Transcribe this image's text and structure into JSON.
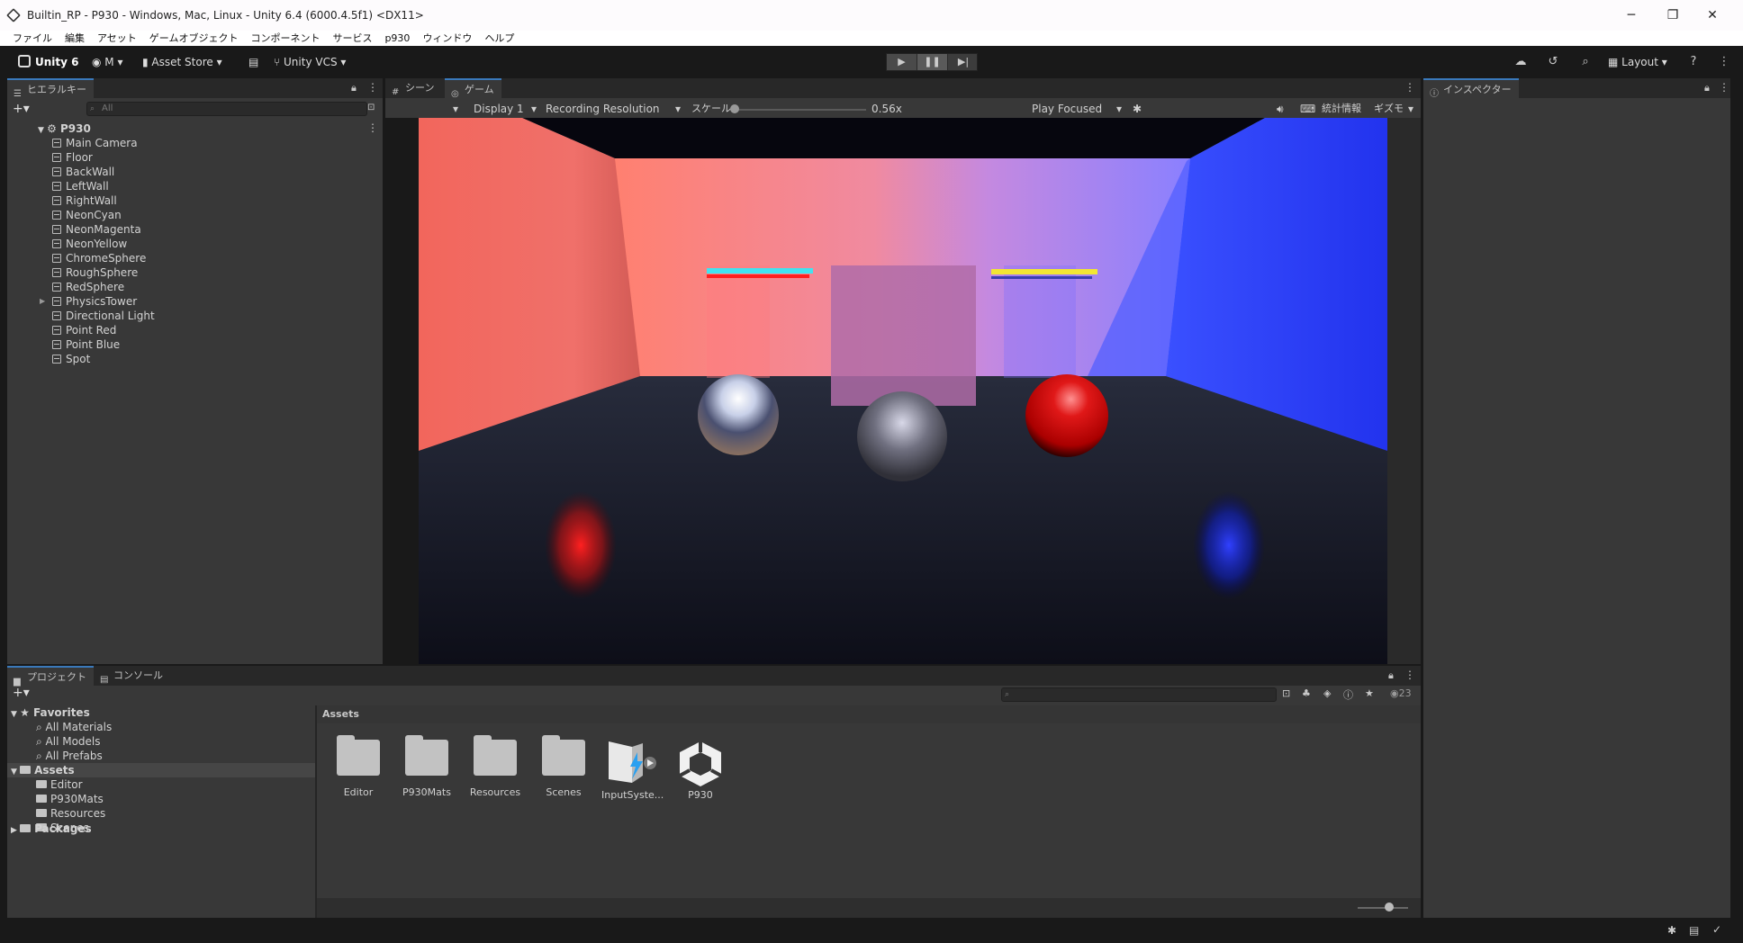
{
  "window": {
    "title": "Builtin_RP - P930 - Windows, Mac, Linux - Unity 6.4 (6000.4.5f1) <DX11>",
    "controls": [
      "─",
      "❐",
      "✕"
    ]
  },
  "menubar": [
    "ファイル",
    "編集",
    "アセット",
    "ゲームオブジェクト",
    "コンポーネント",
    "サービス",
    "p930",
    "ウィンドウ",
    "ヘルプ"
  ],
  "toolbar": {
    "unity": "Unity 6",
    "account": "M",
    "asset_store": "Asset Store",
    "vcs": "Unity VCS",
    "layout": "Layout"
  },
  "hierarchy": {
    "tab": "ヒエラルキー",
    "search_placeholder": "All",
    "scene": "P930",
    "items": [
      "Main Camera",
      "Floor",
      "BackWall",
      "LeftWall",
      "RightWall",
      "NeonCyan",
      "NeonMagenta",
      "NeonYellow",
      "ChromeSphere",
      "RoughSphere",
      "RedSphere",
      "PhysicsTower",
      "Directional Light",
      "Point Red",
      "Point Blue",
      "Spot"
    ]
  },
  "scene_tabs": {
    "scene": "シーン",
    "game": "ゲーム"
  },
  "game_toolbar": {
    "display": "Display 1",
    "resolution": "Recording Resolution (19.",
    "scale_label": "スケール",
    "scale_value": "0.56x",
    "scale_fraction": 0.0,
    "play_mode": "Play Focused",
    "stats": "統計情報",
    "gizmos": "ギズモ"
  },
  "inspector": {
    "tab": "インスペクター"
  },
  "project": {
    "tabs": [
      "プロジェクト",
      "コンソール"
    ],
    "favorites_label": "Favorites",
    "favorites": [
      "All Materials",
      "All Models",
      "All Prefabs"
    ],
    "assets_label": "Assets",
    "asset_folders": [
      "Editor",
      "P930Mats",
      "Resources",
      "Scenes"
    ],
    "packages_label": "Packages",
    "breadcrumb": "Assets",
    "hidden_count": "23",
    "grid": [
      "Editor",
      "P930Mats",
      "Resources",
      "Scenes",
      "InputSyste...",
      "P930"
    ]
  },
  "colors": {
    "accent": "#3a79bb",
    "left_wall": "#f2665c",
    "right_wall": "#2233ee",
    "back_left": "#ff8070",
    "back_right": "#8a80ff",
    "neon_cyan": "#41e3f0",
    "neon_magenta": "#ff2020",
    "neon_yellow": "#f2e634"
  }
}
